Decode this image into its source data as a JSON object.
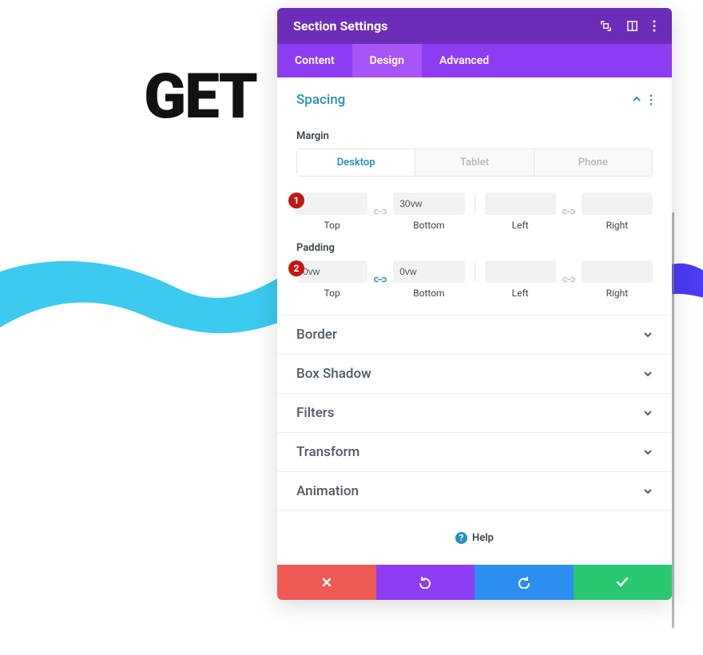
{
  "background_text": "GET",
  "modal": {
    "title": "Section Settings",
    "tabs": {
      "content": "Content",
      "design": "Design",
      "advanced": "Advanced",
      "active": "design"
    }
  },
  "spacing": {
    "title": "Spacing",
    "margin_label": "Margin",
    "padding_label": "Padding",
    "device_tabs": {
      "desktop": "Desktop",
      "tablet": "Tablet",
      "phone": "Phone",
      "active": "desktop"
    },
    "margin": {
      "top": "",
      "bottom": "30vw",
      "left": "",
      "right": "",
      "labels": {
        "top": "Top",
        "bottom": "Bottom",
        "left": "Left",
        "right": "Right"
      },
      "linked_tb": false,
      "linked_lr": false
    },
    "padding": {
      "top": "0vw",
      "bottom": "0vw",
      "left": "",
      "right": "",
      "labels": {
        "top": "Top",
        "bottom": "Bottom",
        "left": "Left",
        "right": "Right"
      },
      "linked_tb": true,
      "linked_lr": false
    }
  },
  "sections": {
    "border": "Border",
    "box_shadow": "Box Shadow",
    "filters": "Filters",
    "transform": "Transform",
    "animation": "Animation"
  },
  "callouts": {
    "one": "1",
    "two": "2"
  },
  "help": "Help",
  "colors": {
    "header": "#6c2eb9",
    "tabs": "#8e3df2",
    "tab_active": "#a855f7",
    "accent": "#2a8fbd",
    "footer_red": "#ef5a55",
    "footer_purple": "#8e3df2",
    "footer_blue": "#2b8ef0",
    "footer_green": "#29c76f",
    "callout": "#c01717"
  }
}
